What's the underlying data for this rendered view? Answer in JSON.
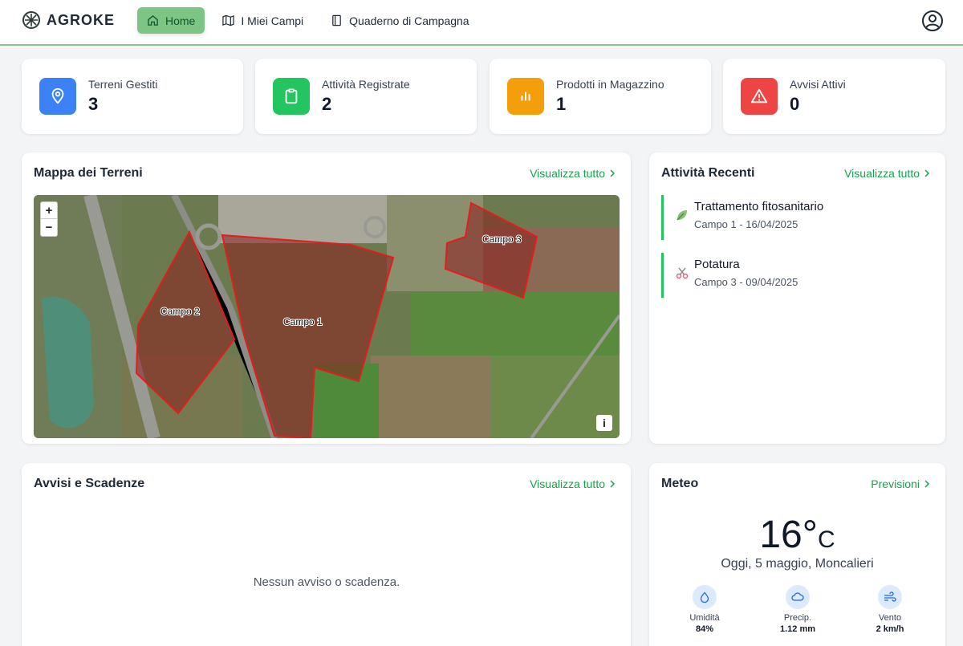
{
  "app": {
    "brand": "AGROKE"
  },
  "nav": [
    {
      "label": "Home",
      "icon": "home-icon",
      "active": true
    },
    {
      "label": "I Miei Campi",
      "icon": "map-icon",
      "active": false
    },
    {
      "label": "Quaderno di Campagna",
      "icon": "notebook-icon",
      "active": false
    }
  ],
  "stats": [
    {
      "label": "Terreni Gestiti",
      "value": "3",
      "color": "#3b82f6",
      "icon": "map-pin-icon"
    },
    {
      "label": "Attività Registrate",
      "value": "2",
      "color": "#22c55e",
      "icon": "clipboard-icon"
    },
    {
      "label": "Prodotti in Magazzino",
      "value": "1",
      "color": "#f59e0b",
      "icon": "bar-chart-icon"
    },
    {
      "label": "Avvisi Attivi",
      "value": "0",
      "color": "#ef4444",
      "icon": "warning-icon"
    }
  ],
  "map_panel": {
    "title": "Mappa dei Terreni",
    "link": "Visualizza tutto",
    "zoom_in": "+",
    "zoom_out": "−",
    "info": "i",
    "fields": [
      "Campo 1",
      "Campo 2",
      "Campo 3"
    ]
  },
  "activities_panel": {
    "title": "Attività Recenti",
    "link": "Visualizza tutto",
    "items": [
      {
        "title": "Trattamento fitosanitario",
        "subtitle": "Campo 1 - 16/04/2025",
        "icon": "leaf-icon"
      },
      {
        "title": "Potatura",
        "subtitle": "Campo 3 - 09/04/2025",
        "icon": "scissors-icon"
      }
    ]
  },
  "alerts_panel": {
    "title": "Avvisi e Scadenze",
    "link": "Visualizza tutto",
    "empty": "Nessun avviso o scadenza."
  },
  "weather_panel": {
    "title": "Meteo",
    "link": "Previsioni",
    "temp": "16°",
    "unit": "C",
    "date": "Oggi, 5 maggio, Moncalieri",
    "stats": [
      {
        "label": "Umidità",
        "value": "84%",
        "icon": "droplet-icon"
      },
      {
        "label": "Precip.",
        "value": "1.12 mm",
        "icon": "cloud-icon"
      },
      {
        "label": "Vento",
        "value": "2 km/h",
        "icon": "wind-icon"
      }
    ]
  }
}
